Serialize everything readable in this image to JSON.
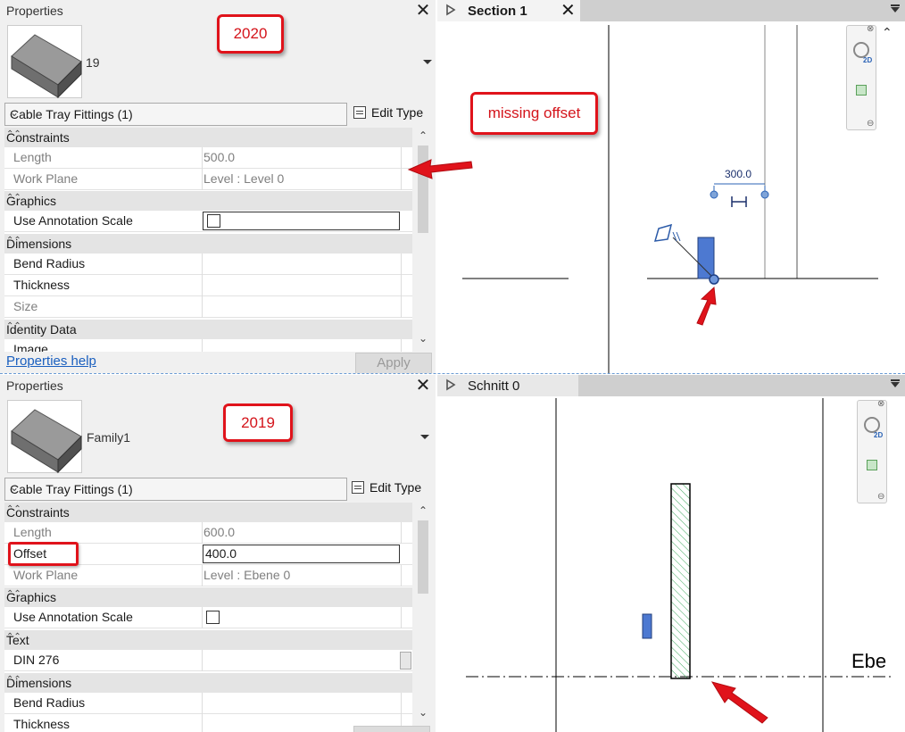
{
  "top_panel": {
    "title": "Properties",
    "family_name": "19",
    "type_selector": "Cable Tray Fittings (1)",
    "edit_type": "Edit Type",
    "categories": {
      "constraints": "Constraints",
      "graphics": "Graphics",
      "dimensions": "Dimensions",
      "identity": "Identity Data"
    },
    "rows": {
      "length_k": "Length",
      "length_v": "500.0",
      "workplane_k": "Work Plane",
      "workplane_v": "Level : Level 0",
      "annot_k": "Use Annotation Scale",
      "bend_k": "Bend Radius",
      "thick_k": "Thickness",
      "size_k": "Size",
      "image_k": "Image"
    },
    "help": "Properties help",
    "apply": "Apply"
  },
  "bottom_panel": {
    "title": "Properties",
    "family_name": "Family1",
    "type_selector": "Cable Tray Fittings (1)",
    "edit_type": "Edit Type",
    "categories": {
      "constraints": "Constraints",
      "graphics": "Graphics",
      "text": "Text",
      "dimensions": "Dimensions"
    },
    "rows": {
      "length_k": "Length",
      "length_v": "600.0",
      "offset_k": "Offset",
      "offset_v": "400.0",
      "workplane_k": "Work Plane",
      "workplane_v": "Level : Ebene 0",
      "annot_k": "Use Annotation Scale",
      "din_k": "DIN 276",
      "bend_k": "Bend Radius",
      "thick_k": "Thickness"
    }
  },
  "top_view": {
    "tab_label": "Section 1",
    "dimension": "300.0",
    "nav_2d": "2D"
  },
  "bottom_view": {
    "tab_label": "Schnitt 0",
    "level_label": "Ebe",
    "nav_2d": "2D"
  },
  "annotations": {
    "label_2020": "2020",
    "label_2019": "2019",
    "missing_offset": "missing offset",
    "accent_color": "#e0131b"
  }
}
